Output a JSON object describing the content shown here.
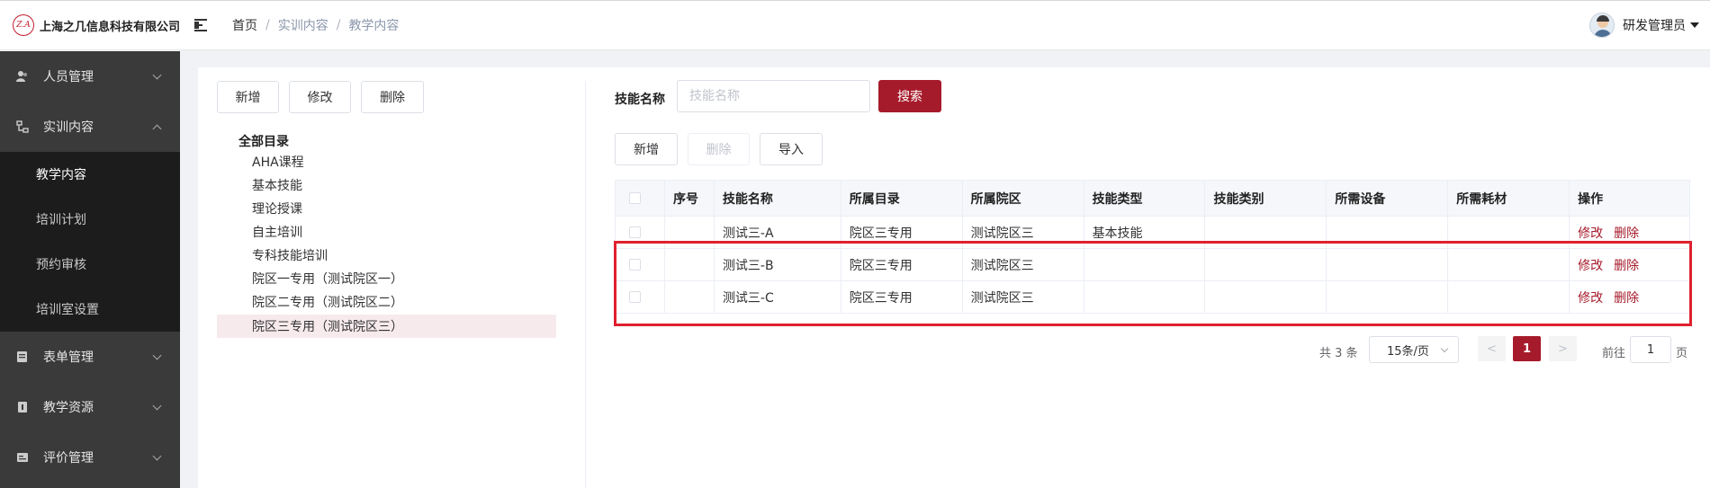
{
  "header": {
    "company": "上海之几信息科技有限公司",
    "logo_mark": "Z.A",
    "breadcrumb": [
      "首页",
      "实训内容",
      "教学内容"
    ],
    "user_name": "研发管理员"
  },
  "sidebar": {
    "menus": [
      {
        "label": "人员管理",
        "icon": "user-icon",
        "expanded": false
      },
      {
        "label": "实训内容",
        "icon": "tree-icon",
        "expanded": true,
        "children": [
          "教学内容",
          "培训计划",
          "预约审核",
          "培训室设置"
        ],
        "active_child": "教学内容"
      },
      {
        "label": "表单管理",
        "icon": "form-icon",
        "expanded": false
      },
      {
        "label": "教学资源",
        "icon": "resource-icon",
        "expanded": false
      },
      {
        "label": "评价管理",
        "icon": "evaluation-icon",
        "expanded": false
      }
    ]
  },
  "left_toolbar": {
    "add": "新增",
    "edit": "修改",
    "delete": "删除"
  },
  "tree": {
    "root": "全部目录",
    "nodes": [
      "AHA课程",
      "基本技能",
      "理论授课",
      "自主培训",
      "专科技能培训",
      "院区一专用（测试院区一）",
      "院区二专用（测试院区二）",
      "院区三专用（测试院区三）"
    ],
    "selected_index": 7
  },
  "search": {
    "label": "技能名称",
    "placeholder": "技能名称",
    "value": "",
    "button": "搜索"
  },
  "right_toolbar": {
    "add": "新增",
    "delete": "删除",
    "import": "导入"
  },
  "table": {
    "columns": [
      "",
      "序号",
      "技能名称",
      "所属目录",
      "所属院区",
      "技能类型",
      "技能类别",
      "所需设备",
      "所需耗材",
      "操作"
    ],
    "rows": [
      {
        "index": "",
        "name": "测试三-A",
        "catalog": "院区三专用",
        "campus": "测试院区三",
        "type": "基本技能",
        "category": "",
        "equipment": "",
        "supplies": ""
      },
      {
        "index": "",
        "name": "测试三-B",
        "catalog": "院区三专用",
        "campus": "测试院区三",
        "type": "",
        "category": "",
        "equipment": "",
        "supplies": ""
      },
      {
        "index": "",
        "name": "测试三-C",
        "catalog": "院区三专用",
        "campus": "测试院区三",
        "type": "",
        "category": "",
        "equipment": "",
        "supplies": ""
      }
    ],
    "actions": {
      "edit": "修改",
      "delete": "删除"
    }
  },
  "pagination": {
    "total_text": "共 3 条",
    "page_size": "15条/页",
    "current_page": "1",
    "goto_label": "前往",
    "goto_value": "1",
    "unit": "页",
    "prev": "<",
    "next": ">"
  },
  "colors": {
    "brand": "#a61b2b",
    "sidebar_bg": "#3a3a3a",
    "submenu_bg": "#1c1c1c",
    "highlight": "#e0202f"
  }
}
